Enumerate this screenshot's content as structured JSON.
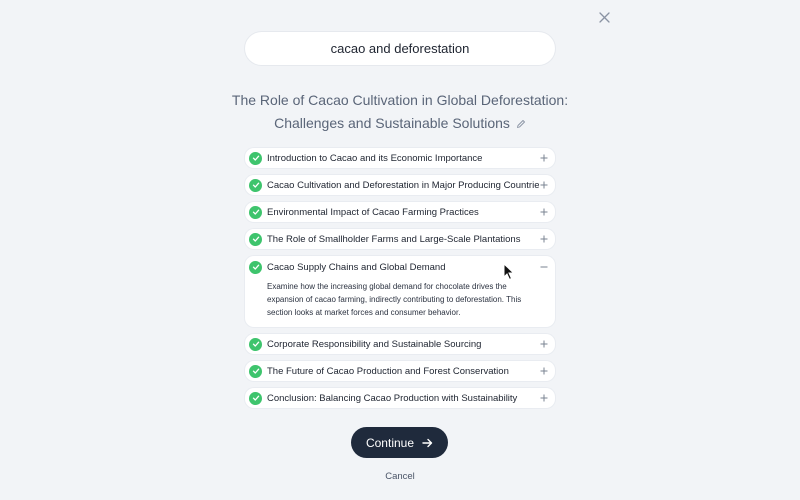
{
  "search": {
    "query": "cacao and deforestation"
  },
  "title": {
    "line1": "The Role of Cacao Cultivation in Global Deforestation:",
    "line2": "Challenges and Sustainable Solutions"
  },
  "outline": {
    "sections": [
      {
        "label": "Introduction to Cacao and its Economic Importance",
        "checked": true,
        "expanded": false
      },
      {
        "label": "Cacao Cultivation and Deforestation in Major Producing Countries",
        "checked": true,
        "expanded": false
      },
      {
        "label": "Environmental Impact of Cacao Farming Practices",
        "checked": true,
        "expanded": false
      },
      {
        "label": "The Role of Smallholder Farms and Large-Scale Plantations",
        "checked": true,
        "expanded": false
      },
      {
        "label": "Cacao Supply Chains and Global Demand",
        "checked": true,
        "expanded": true,
        "description": "Examine how the increasing global demand for chocolate drives the expansion of cacao farming, indirectly contributing to deforestation. This section looks at market forces and consumer behavior."
      },
      {
        "label": "Corporate Responsibility and Sustainable Sourcing",
        "checked": true,
        "expanded": false
      },
      {
        "label": "The Future of Cacao Production and Forest Conservation",
        "checked": true,
        "expanded": false
      },
      {
        "label": "Conclusion: Balancing Cacao Production with Sustainability",
        "checked": true,
        "expanded": false
      }
    ]
  },
  "actions": {
    "continue_label": "Continue",
    "cancel_label": "Cancel"
  },
  "colors": {
    "accent": "#1f2a3c",
    "check": "#3ec46d",
    "background": "#f2f4f7"
  }
}
